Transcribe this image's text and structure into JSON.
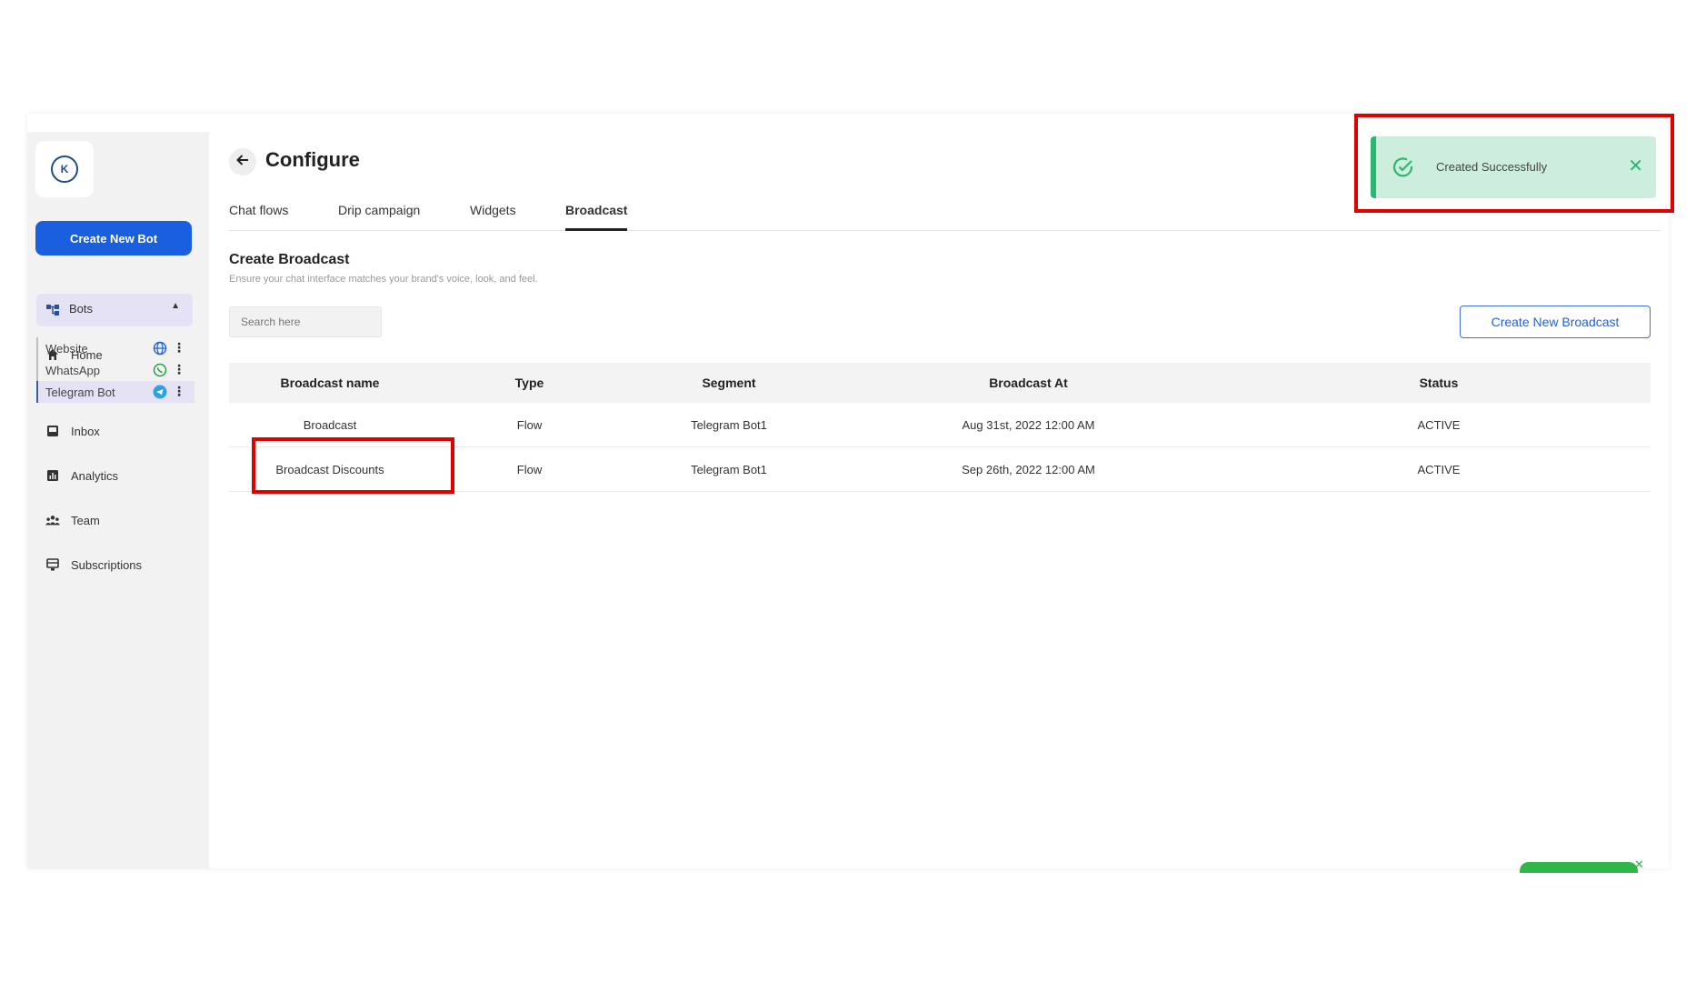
{
  "sidebar": {
    "logo_letter": "K",
    "create_bot_label": "Create New Bot",
    "nav": {
      "home": "Home",
      "bots": "Bots",
      "inbox": "Inbox",
      "analytics": "Analytics",
      "team": "Team",
      "subscriptions": "Subscriptions"
    },
    "bots": [
      {
        "label": "Website",
        "channel_icon": "globe-icon",
        "color": "#1a5fe0"
      },
      {
        "label": "WhatsApp",
        "channel_icon": "whatsapp-icon",
        "color": "#25a244"
      },
      {
        "label": "Telegram Bot",
        "channel_icon": "telegram-icon",
        "color": "#2aa3e0"
      }
    ]
  },
  "header": {
    "title": "Configure",
    "tabs": [
      "Chat flows",
      "Drip campaign",
      "Widgets",
      "Broadcast"
    ],
    "active_tab": "Broadcast"
  },
  "section": {
    "title": "Create Broadcast",
    "subtitle": "Ensure your chat interface matches your brand's voice, look, and feel."
  },
  "search": {
    "placeholder": "Search here"
  },
  "create_broadcast_label": "Create New Broadcast",
  "table": {
    "headers": [
      "Broadcast name",
      "Type",
      "Segment",
      "Broadcast At",
      "Status"
    ],
    "rows": [
      [
        "Broadcast",
        "Flow",
        "Telegram Bot1",
        "Aug 31st, 2022 12:00 AM",
        "ACTIVE"
      ],
      [
        "Broadcast Discounts",
        "Flow",
        "Telegram Bot1",
        "Sep 26th, 2022 12:00 AM",
        "ACTIVE"
      ]
    ]
  },
  "toast": {
    "message": "Created Successfully",
    "color": "#2bb673"
  },
  "colors": {
    "primary": "#1a5fe0",
    "highlight": "#e00000"
  }
}
